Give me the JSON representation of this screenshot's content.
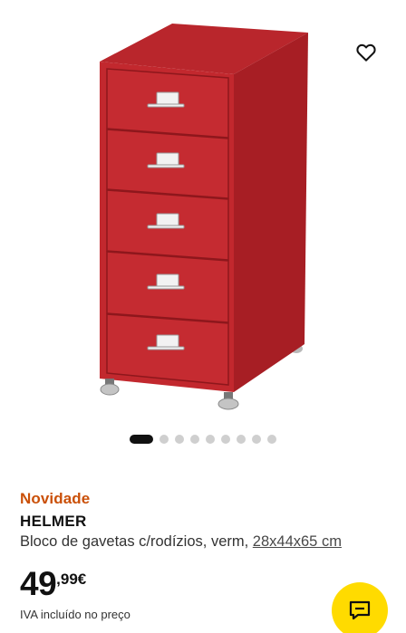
{
  "product": {
    "badge": "Novidade",
    "name": "HELMER",
    "description": "Bloco de gavetas c/rodízios, verm,",
    "dimensions": "28x44x65 cm",
    "price_integer": "49",
    "price_decimal": ",99€",
    "vat_note": "IVA incluído no preço"
  },
  "carousel": {
    "total_images": 9,
    "active_index": 0
  },
  "colors": {
    "badge": "#ca5008",
    "cabinet_red": "#c1272d",
    "chat_button": "#ffdb00",
    "dot_active": "#111111",
    "dot_inactive": "#cfcfcf"
  },
  "icons": {
    "favourite": "heart-icon",
    "chat": "chat-icon"
  }
}
